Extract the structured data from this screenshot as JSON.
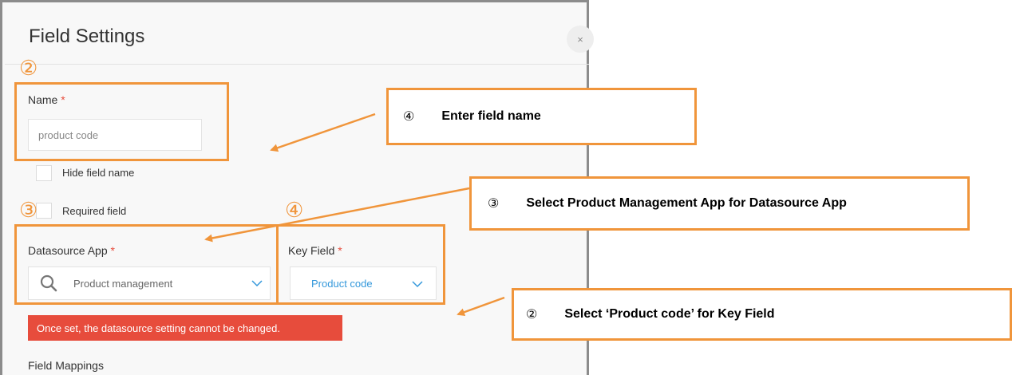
{
  "dialog": {
    "title": "Field Settings",
    "close": "×",
    "name_label": "Name",
    "required_mark": "*",
    "name_value": "product code",
    "hide_field_name": "Hide field name",
    "required_field": "Required field",
    "datasource_label": "Datasource App",
    "datasource_value": "Product management",
    "key_field_label": "Key Field",
    "key_field_value": "Product code",
    "error_message": "Once set, the datasource setting cannot be changed.",
    "field_mappings": "Field Mappings"
  },
  "markers": {
    "name": "②",
    "datasource": "③",
    "key_field": "④"
  },
  "callouts": [
    {
      "number": "④",
      "text": "Enter field name"
    },
    {
      "number": "③",
      "text": "Select Product Management App for Datasource App"
    },
    {
      "number": "②",
      "text": "Select ‘Product code’ for Key Field"
    }
  ],
  "colors": {
    "accent_orange": "#f0953b",
    "error_red": "#e74c3c",
    "link_blue": "#3498db"
  }
}
